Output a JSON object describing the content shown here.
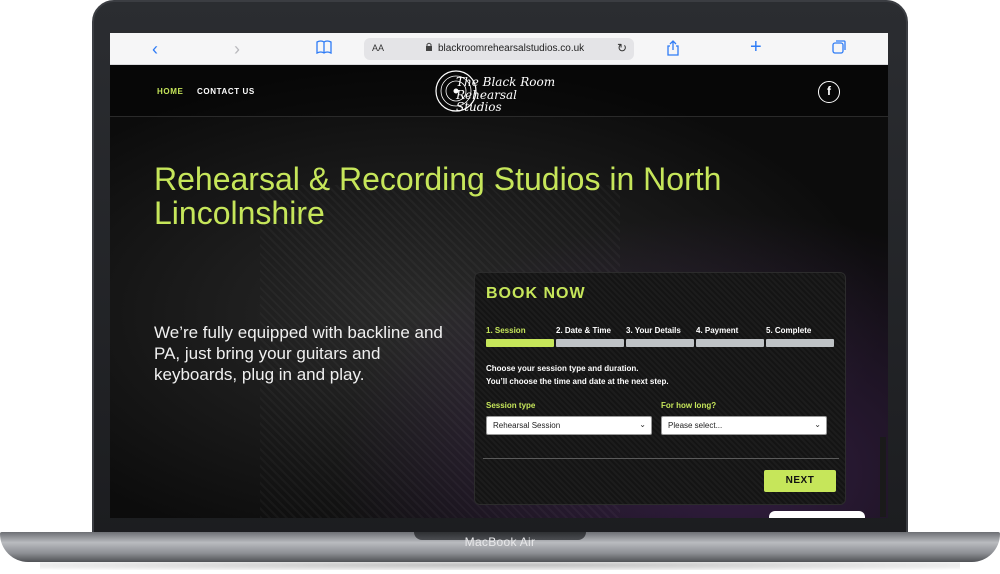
{
  "device": {
    "label": "MacBook Air"
  },
  "browser": {
    "text_size": "AA",
    "url": "blackroomrehearsalstudios.co.uk",
    "icons": {
      "back": "chevron-left-icon",
      "forward": "chevron-right-icon",
      "bookmarks": "book-icon",
      "share": "share-icon",
      "new_tab": "plus-icon",
      "tabs": "tabs-icon",
      "reload": "reload-icon",
      "lock": "lock-icon"
    }
  },
  "site": {
    "nav": {
      "home": "HOME",
      "contact": "CONTACT US"
    },
    "logo": {
      "line1": "The Black Room",
      "line2": "Rehearsal Studios"
    },
    "social": {
      "facebook": "f"
    },
    "hero": {
      "title": "Rehearsal & Recording Studios in North Lincolnshire",
      "body": "We’re fully equipped with backline and PA, just bring your guitars and keyboards, plug in and play."
    },
    "booking": {
      "title": "BOOK NOW",
      "steps": [
        {
          "label": "1. Session",
          "active": true
        },
        {
          "label": "2. Date & Time",
          "active": false
        },
        {
          "label": "3. Your Details",
          "active": false
        },
        {
          "label": "4. Payment",
          "active": false
        },
        {
          "label": "5. Complete",
          "active": false
        }
      ],
      "instructions_line1": "Choose your session type and duration.",
      "instructions_line2": "You’ll choose the time and date at the next step.",
      "session_type": {
        "label": "Session type",
        "value": "Rehearsal Session"
      },
      "duration": {
        "label": "For how long?",
        "value": "Please select..."
      },
      "next": "NEXT"
    },
    "colors": {
      "accent": "#c6e65a",
      "background": "#0c0c0c",
      "text": "#ffffff"
    }
  }
}
